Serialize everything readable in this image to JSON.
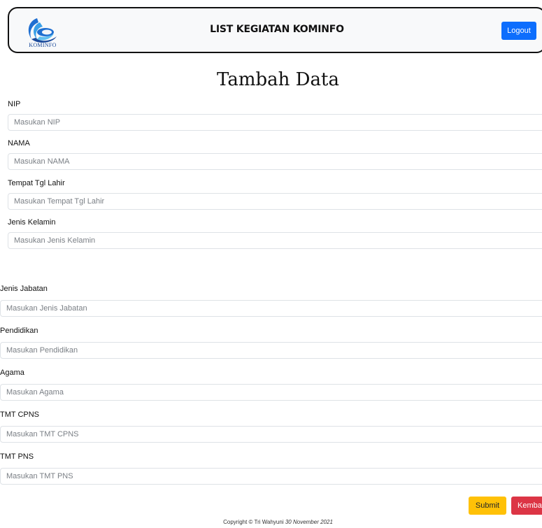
{
  "header": {
    "logo_text": "KOMINFO",
    "title": "LIST KEGIATAN KOMINFO",
    "logout_label": "Logout"
  },
  "page_title": "Tambah Data",
  "form": {
    "fields": [
      {
        "label": "NIP",
        "placeholder": "Masukan NIP",
        "value": ""
      },
      {
        "label": "NAMA",
        "placeholder": "Masukan NAMA",
        "value": ""
      },
      {
        "label": "Tempat Tgl Lahir",
        "placeholder": "Masukan Tempat Tgl Lahir",
        "value": ""
      },
      {
        "label": "Jenis Kelamin",
        "placeholder": "Masukan Jenis Kelamin",
        "value": ""
      },
      {
        "label": "Jenis Jabatan",
        "placeholder": "Masukan Jenis Jabatan",
        "value": ""
      },
      {
        "label": "Pendidikan",
        "placeholder": "Masukan Pendidikan",
        "value": ""
      },
      {
        "label": "Agama",
        "placeholder": "Masukan Agama",
        "value": ""
      },
      {
        "label": "TMT CPNS",
        "placeholder": "Masukan TMT CPNS",
        "value": ""
      },
      {
        "label": "TMT PNS",
        "placeholder": "Masukan TMT PNS",
        "value": ""
      }
    ],
    "submit_label": "Submit",
    "back_label": "Kemba"
  },
  "footer": {
    "copyright": "Copyright © Tri Wahyuni",
    "date": "30 November 2021"
  },
  "colors": {
    "primary": "#0d6efd",
    "warning": "#ffc107",
    "danger": "#dc3545"
  }
}
